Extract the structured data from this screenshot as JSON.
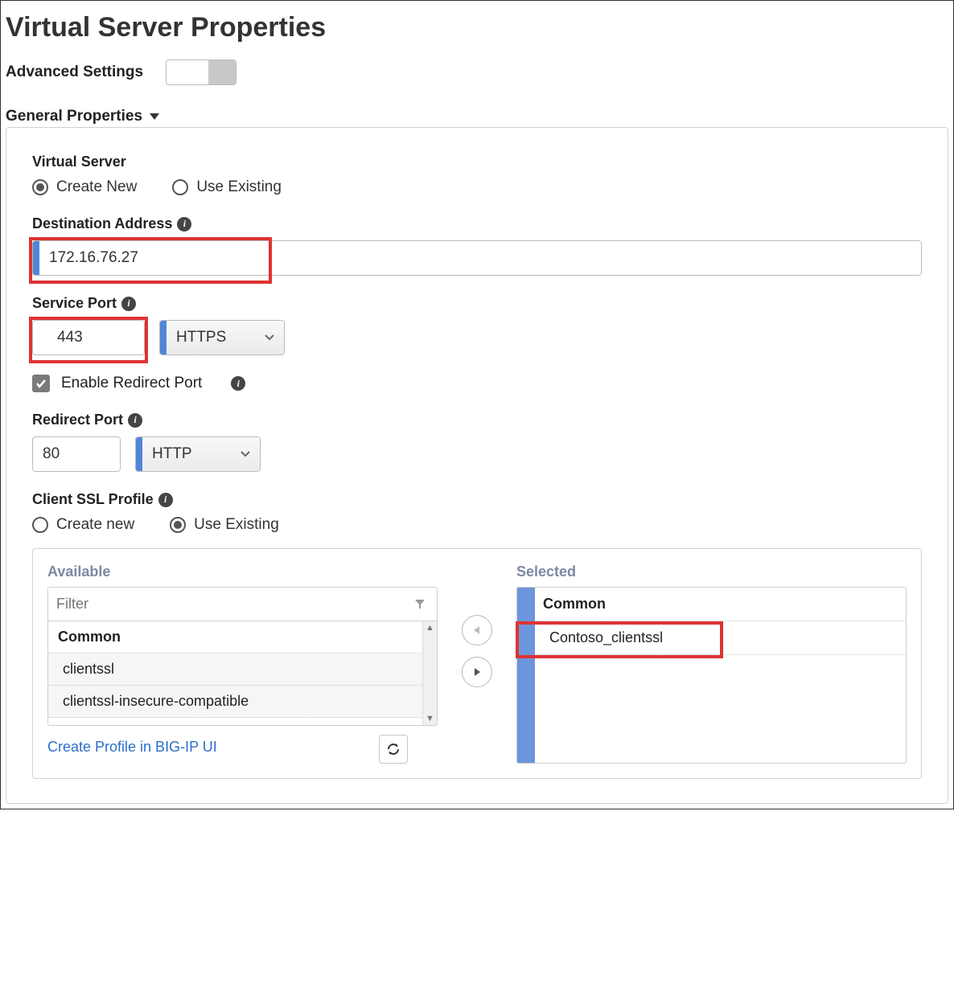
{
  "title": "Virtual Server Properties",
  "advanced": {
    "label": "Advanced Settings",
    "on": false
  },
  "section": {
    "header": "General Properties"
  },
  "virtualServer": {
    "label": "Virtual Server",
    "createNew": "Create New",
    "useExisting": "Use Existing",
    "selected": "createNew"
  },
  "destAddr": {
    "label": "Destination Address",
    "value": "172.16.76.27"
  },
  "svcPort": {
    "label": "Service Port",
    "value": "443",
    "protocol": "HTTPS"
  },
  "enableRedirect": {
    "label": "Enable Redirect Port",
    "checked": true
  },
  "redirectPort": {
    "label": "Redirect Port",
    "value": "80",
    "protocol": "HTTP"
  },
  "clientSsl": {
    "label": "Client SSL Profile",
    "createNew": "Create new",
    "useExisting": "Use Existing",
    "selected": "useExisting"
  },
  "sslPicker": {
    "availableLabel": "Available",
    "filterPlaceholder": "Filter",
    "availableGroup": "Common",
    "availableItems": [
      "clientssl",
      "clientssl-insecure-compatible"
    ],
    "createProfileLink": "Create Profile in BIG-IP UI",
    "selectedLabel": "Selected",
    "selectedGroup": "Common",
    "selectedItems": [
      "Contoso_clientssl"
    ]
  }
}
